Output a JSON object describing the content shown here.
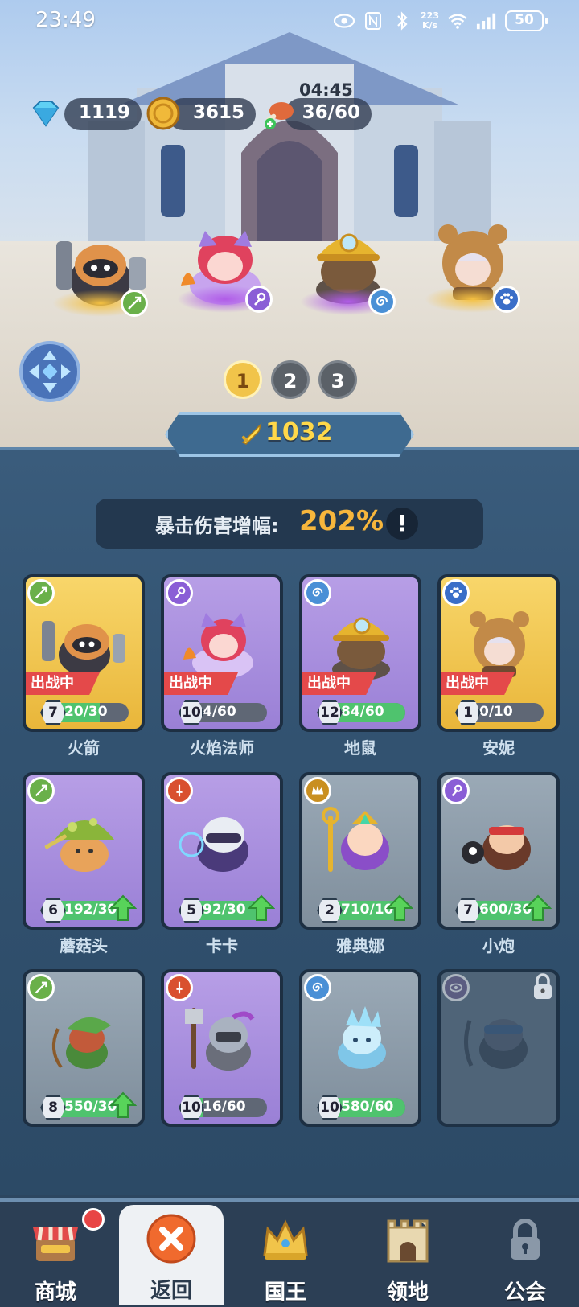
{
  "status_bar": {
    "time": "23:49",
    "net_speed": "223",
    "net_unit": "K/s",
    "battery": "50"
  },
  "resources": {
    "gems": "1119",
    "coins": "3615",
    "stamina": "36/60",
    "stamina_timer": "04:45"
  },
  "team_pages": [
    "1",
    "2",
    "3"
  ],
  "power": "1032",
  "crit": {
    "label": "暴击伤害增幅:",
    "value": "202%",
    "info": "!"
  },
  "deploy_label": "出战中",
  "heroes": [
    {
      "name": "火箭",
      "level": "7",
      "progress": "20/30",
      "fraction": 0.67,
      "deployed": true
    },
    {
      "name": "火焰法师",
      "level": "10",
      "progress": "4/60",
      "fraction": 0.07,
      "deployed": true
    },
    {
      "name": "地鼠",
      "level": "12",
      "progress": "84/60",
      "fraction": 1.0,
      "deployed": true
    },
    {
      "name": "安妮",
      "level": "1",
      "progress": "0/10",
      "fraction": 0.0,
      "deployed": true
    },
    {
      "name": "蘑菇头",
      "level": "6",
      "progress": "192/30",
      "fraction": 1.0,
      "upgrade": true
    },
    {
      "name": "卡卡",
      "level": "5",
      "progress": "92/30",
      "fraction": 1.0,
      "upgrade": true
    },
    {
      "name": "雅典娜",
      "level": "2",
      "progress": "710/10",
      "fraction": 1.0,
      "upgrade": true
    },
    {
      "name": "小炮",
      "level": "7",
      "progress": "600/30",
      "fraction": 1.0,
      "upgrade": true
    },
    {
      "name": "",
      "level": "8",
      "progress": "550/30",
      "fraction": 1.0,
      "upgrade": true
    },
    {
      "name": "",
      "level": "10",
      "progress": "16/60",
      "fraction": 0.27
    },
    {
      "name": "",
      "level": "10",
      "progress": "580/60",
      "fraction": 1.0
    },
    {
      "name": "",
      "locked": true
    }
  ],
  "nav": {
    "shop": "商城",
    "back": "返回",
    "king": "国王",
    "territory": "领地",
    "guild": "公会"
  },
  "colors": {
    "yellow_card": "#f8d66a",
    "purple_card": "#b79ee6",
    "gray_card": "#9aa9b6",
    "progress_green": "#4fc36e",
    "power_gold": "#ffd84a",
    "crit_orange": "#f7b63c"
  }
}
